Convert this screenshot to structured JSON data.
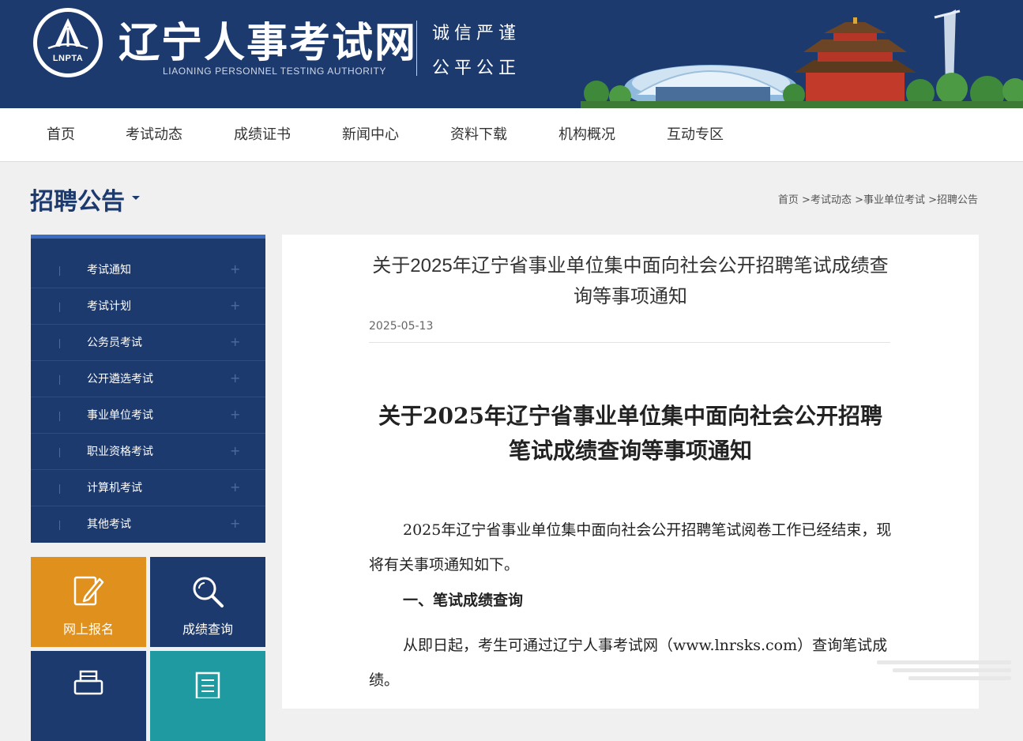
{
  "header": {
    "logo_abbr": "LNPTA",
    "site_title": "辽宁人事考试网",
    "site_subtitle": "LIAONING PERSONNEL TESTING AUTHORITY",
    "motto_line1": "诚信严谨",
    "motto_line2": "公平公正"
  },
  "nav": {
    "items": [
      "首页",
      "考试动态",
      "成绩证书",
      "新闻中心",
      "资料下载",
      "机构概况",
      "互动专区"
    ]
  },
  "section": {
    "title": "招聘公告",
    "breadcrumb": "首页 >考试动态 >事业单位考试 >招聘公告"
  },
  "sidebar": {
    "items": [
      "考试通知",
      "考试计划",
      "公务员考试",
      "公开遴选考试",
      "事业单位考试",
      "职业资格考试",
      "计算机考试",
      "其他考试"
    ],
    "expand_symbol": "+"
  },
  "tiles": [
    {
      "label": "网上报名",
      "icon": "edit-icon",
      "color": "#e0901d"
    },
    {
      "label": "成绩查询",
      "icon": "search-icon",
      "color": "#1d3a6e"
    },
    {
      "label": "",
      "icon": "printer-icon",
      "color": "#1d3a6e"
    },
    {
      "label": "",
      "icon": "document-icon",
      "color": "#1e9aa0"
    }
  ],
  "article": {
    "title": "关于2025年辽宁省事业单位集中面向社会公开招聘笔试成绩查询等事项通知",
    "date": "2025-05-13",
    "doc_title": "关于2025年辽宁省事业单位集中面向社会公开招聘笔试成绩查询等事项通知",
    "paragraph1": "2025年辽宁省事业单位集中面向社会公开招聘笔试阅卷工作已经结束，现将有关事项通知如下。",
    "heading1": "一、笔试成绩查询",
    "paragraph2": "从即日起，考生可通过辽宁人事考试网（www.lnrsks.com）查询笔试成绩。"
  },
  "colors": {
    "brand_navy": "#1d3a6e",
    "accent_blue": "#3b6cc0",
    "orange": "#e0901d",
    "teal": "#1e9aa0"
  }
}
